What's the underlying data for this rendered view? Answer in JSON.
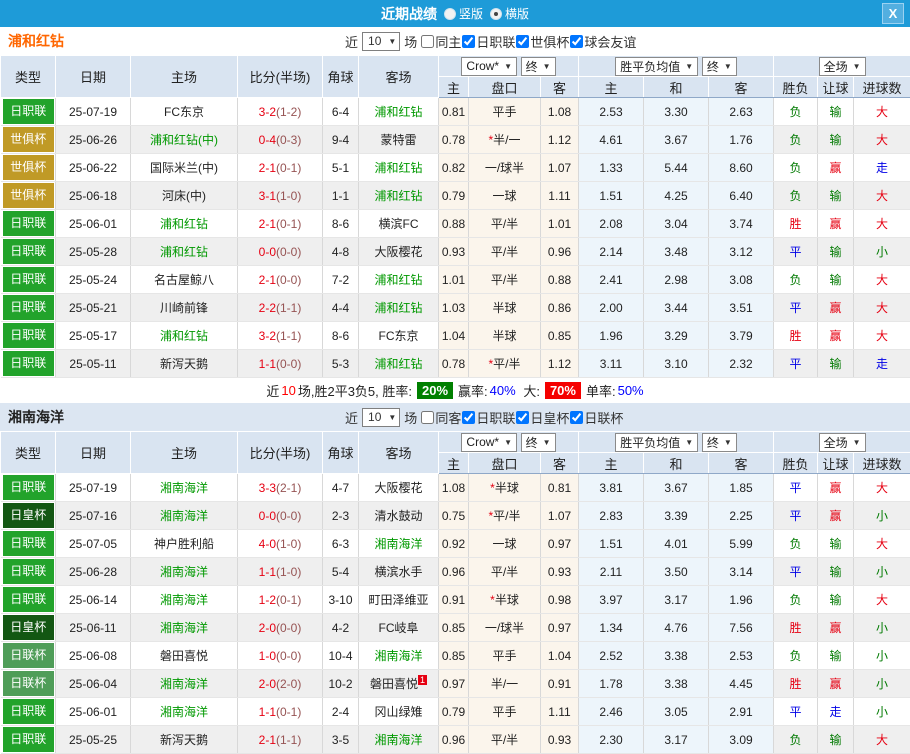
{
  "titlebar": {
    "title": "近期战绩",
    "radio_vertical": "竖版",
    "radio_horizontal": "横版",
    "horizontal_selected": true,
    "close_glyph": "X",
    "bar_color": "#1E9BD8"
  },
  "table_header": {
    "type": "类型",
    "date": "日期",
    "home": "主场",
    "score": "比分(半场)",
    "corner": "角球",
    "away": "客场",
    "company": "Crow*",
    "final": "终",
    "avg": "胜平负均值",
    "final2": "终",
    "scope": "全场",
    "h": "主",
    "handicap": "盘口",
    "a": "客",
    "h2": "主",
    "draw": "和",
    "a2": "客",
    "wdl": "胜负",
    "let": "让球",
    "goals": "进球数"
  },
  "sections": [
    {
      "team": "浦和红钻",
      "filters": {
        "near_label": "近",
        "count": "10",
        "games_label": "场",
        "checkboxes": [
          {
            "label": "同主",
            "checked": false
          },
          {
            "label": "日职联",
            "checked": true
          },
          {
            "label": "世俱杯",
            "checked": true
          },
          {
            "label": "球会友谊",
            "checked": true
          }
        ]
      },
      "rows": [
        {
          "lg": "日职联",
          "lgc": "#22A32B",
          "d": "25-07-19",
          "h": "FC东京",
          "hg": false,
          "s": "3-2",
          "ht": "(1-2)",
          "cn": "6-4",
          "a": "浦和红钻",
          "ag": true,
          "o1": "0.81",
          "st": false,
          "hc": "平手",
          "o2": "1.08",
          "m1": "2.53",
          "m2": "3.30",
          "m3": "2.63",
          "r1": [
            "负",
            "g"
          ],
          "r2": [
            "输",
            "g"
          ],
          "r3": [
            "大",
            "r"
          ]
        },
        {
          "lg": "世俱杯",
          "lgc": "#C09A26",
          "d": "25-06-26",
          "h": "浦和红钻(中)",
          "hg": true,
          "s": "0-4",
          "ht": "(0-3)",
          "cn": "9-4",
          "a": "蒙特雷",
          "ag": false,
          "o1": "0.78",
          "st": true,
          "hc": "半/一",
          "o2": "1.12",
          "m1": "4.61",
          "m2": "3.67",
          "m3": "1.76",
          "r1": [
            "负",
            "g"
          ],
          "r2": [
            "输",
            "g"
          ],
          "r3": [
            "大",
            "r"
          ]
        },
        {
          "lg": "世俱杯",
          "lgc": "#C09A26",
          "d": "25-06-22",
          "h": "国际米兰(中)",
          "hg": false,
          "s": "2-1",
          "ht": "(0-1)",
          "cn": "5-1",
          "a": "浦和红钻",
          "ag": true,
          "o1": "0.82",
          "st": false,
          "hc": "一/球半",
          "o2": "1.07",
          "m1": "1.33",
          "m2": "5.44",
          "m3": "8.60",
          "r1": [
            "负",
            "g"
          ],
          "r2": [
            "赢",
            "r"
          ],
          "r3": [
            "走",
            "b"
          ]
        },
        {
          "lg": "世俱杯",
          "lgc": "#C09A26",
          "d": "25-06-18",
          "h": "河床(中)",
          "hg": false,
          "s": "3-1",
          "ht": "(1-0)",
          "cn": "1-1",
          "a": "浦和红钻",
          "ag": true,
          "o1": "0.79",
          "st": false,
          "hc": "一球",
          "o2": "1.11",
          "m1": "1.51",
          "m2": "4.25",
          "m3": "6.40",
          "r1": [
            "负",
            "g"
          ],
          "r2": [
            "输",
            "g"
          ],
          "r3": [
            "大",
            "r"
          ]
        },
        {
          "lg": "日职联",
          "lgc": "#22A32B",
          "d": "25-06-01",
          "h": "浦和红钻",
          "hg": true,
          "s": "2-1",
          "ht": "(0-1)",
          "cn": "8-6",
          "a": "横滨FC",
          "ag": false,
          "o1": "0.88",
          "st": false,
          "hc": "平/半",
          "o2": "1.01",
          "m1": "2.08",
          "m2": "3.04",
          "m3": "3.74",
          "r1": [
            "胜",
            "r"
          ],
          "r2": [
            "赢",
            "r"
          ],
          "r3": [
            "大",
            "r"
          ]
        },
        {
          "lg": "日职联",
          "lgc": "#22A32B",
          "d": "25-05-28",
          "h": "浦和红钻",
          "hg": true,
          "s": "0-0",
          "ht": "(0-0)",
          "cn": "4-8",
          "a": "大阪樱花",
          "ag": false,
          "o1": "0.93",
          "st": false,
          "hc": "平/半",
          "o2": "0.96",
          "m1": "2.14",
          "m2": "3.48",
          "m3": "3.12",
          "r1": [
            "平",
            "b"
          ],
          "r2": [
            "输",
            "g"
          ],
          "r3": [
            "小",
            "g"
          ]
        },
        {
          "lg": "日职联",
          "lgc": "#22A32B",
          "d": "25-05-24",
          "h": "名古屋鲸八",
          "hg": false,
          "s": "2-1",
          "ht": "(0-0)",
          "cn": "7-2",
          "a": "浦和红钻",
          "ag": true,
          "o1": "1.01",
          "st": false,
          "hc": "平/半",
          "o2": "0.88",
          "m1": "2.41",
          "m2": "2.98",
          "m3": "3.08",
          "r1": [
            "负",
            "g"
          ],
          "r2": [
            "输",
            "g"
          ],
          "r3": [
            "大",
            "r"
          ]
        },
        {
          "lg": "日职联",
          "lgc": "#22A32B",
          "d": "25-05-21",
          "h": "川崎前锋",
          "hg": false,
          "s": "2-2",
          "ht": "(1-1)",
          "cn": "4-4",
          "a": "浦和红钻",
          "ag": true,
          "o1": "1.03",
          "st": false,
          "hc": "半球",
          "o2": "0.86",
          "m1": "2.00",
          "m2": "3.44",
          "m3": "3.51",
          "r1": [
            "平",
            "b"
          ],
          "r2": [
            "赢",
            "r"
          ],
          "r3": [
            "大",
            "r"
          ]
        },
        {
          "lg": "日职联",
          "lgc": "#22A32B",
          "d": "25-05-17",
          "h": "浦和红钻",
          "hg": true,
          "s": "3-2",
          "ht": "(1-1)",
          "cn": "8-6",
          "a": "FC东京",
          "ag": false,
          "o1": "1.04",
          "st": false,
          "hc": "半球",
          "o2": "0.85",
          "m1": "1.96",
          "m2": "3.29",
          "m3": "3.79",
          "r1": [
            "胜",
            "r"
          ],
          "r2": [
            "赢",
            "r"
          ],
          "r3": [
            "大",
            "r"
          ]
        },
        {
          "lg": "日职联",
          "lgc": "#22A32B",
          "d": "25-05-11",
          "h": "新泻天鹅",
          "hg": false,
          "s": "1-1",
          "ht": "(0-0)",
          "cn": "5-3",
          "a": "浦和红钻",
          "ag": true,
          "o1": "0.78",
          "st": true,
          "hc": "平/半",
          "o2": "1.12",
          "m1": "3.11",
          "m2": "3.10",
          "m3": "2.32",
          "r1": [
            "平",
            "b"
          ],
          "r2": [
            "输",
            "g"
          ],
          "r3": [
            "走",
            "b"
          ]
        }
      ],
      "summary": {
        "near": "近",
        "count": "10",
        "record": "场,胜2平3负5, 胜率:",
        "win_rate": "20%",
        "label_win": "赢率:",
        "win_odds_rate": "40%",
        "label_big": "大:",
        "big_rate": "70%",
        "label_single": "单率:",
        "single_rate": "50%"
      }
    },
    {
      "team": "湘南海洋",
      "filters": {
        "near_label": "近",
        "count": "10",
        "games_label": "场",
        "checkboxes": [
          {
            "label": "同客",
            "checked": false
          },
          {
            "label": "日职联",
            "checked": true
          },
          {
            "label": "日皇杯",
            "checked": true
          },
          {
            "label": "日联杯",
            "checked": true
          }
        ]
      },
      "rows": [
        {
          "lg": "日职联",
          "lgc": "#22A32B",
          "d": "25-07-19",
          "h": "湘南海洋",
          "hg": true,
          "s": "3-3",
          "ht": "(2-1)",
          "cn": "4-7",
          "a": "大阪樱花",
          "ag": false,
          "o1": "1.08",
          "st": true,
          "hc": "半球",
          "o2": "0.81",
          "m1": "3.81",
          "m2": "3.67",
          "m3": "1.85",
          "r1": [
            "平",
            "b"
          ],
          "r2": [
            "赢",
            "r"
          ],
          "r3": [
            "大",
            "r"
          ]
        },
        {
          "lg": "日皇杯",
          "lgc": "#135713",
          "d": "25-07-16",
          "h": "湘南海洋",
          "hg": true,
          "s": "0-0",
          "ht": "(0-0)",
          "cn": "2-3",
          "a": "清水鼓动",
          "ag": false,
          "o1": "0.75",
          "st": true,
          "hc": "平/半",
          "o2": "1.07",
          "m1": "2.83",
          "m2": "3.39",
          "m3": "2.25",
          "r1": [
            "平",
            "b"
          ],
          "r2": [
            "赢",
            "r"
          ],
          "r3": [
            "小",
            "g"
          ]
        },
        {
          "lg": "日职联",
          "lgc": "#22A32B",
          "d": "25-07-05",
          "h": "神户胜利船",
          "hg": false,
          "s": "4-0",
          "ht": "(1-0)",
          "cn": "6-3",
          "a": "湘南海洋",
          "ag": true,
          "o1": "0.92",
          "st": false,
          "hc": "一球",
          "o2": "0.97",
          "m1": "1.51",
          "m2": "4.01",
          "m3": "5.99",
          "r1": [
            "负",
            "g"
          ],
          "r2": [
            "输",
            "g"
          ],
          "r3": [
            "大",
            "r"
          ]
        },
        {
          "lg": "日职联",
          "lgc": "#22A32B",
          "d": "25-06-28",
          "h": "湘南海洋",
          "hg": true,
          "s": "1-1",
          "ht": "(1-0)",
          "cn": "5-4",
          "a": "横滨水手",
          "ag": false,
          "o1": "0.96",
          "st": false,
          "hc": "平/半",
          "o2": "0.93",
          "m1": "2.11",
          "m2": "3.50",
          "m3": "3.14",
          "r1": [
            "平",
            "b"
          ],
          "r2": [
            "输",
            "g"
          ],
          "r3": [
            "小",
            "g"
          ]
        },
        {
          "lg": "日职联",
          "lgc": "#22A32B",
          "d": "25-06-14",
          "h": "湘南海洋",
          "hg": true,
          "s": "1-2",
          "ht": "(0-1)",
          "cn": "3-10",
          "a": "町田泽维亚",
          "ag": false,
          "o1": "0.91",
          "st": true,
          "hc": "半球",
          "o2": "0.98",
          "m1": "3.97",
          "m2": "3.17",
          "m3": "1.96",
          "r1": [
            "负",
            "g"
          ],
          "r2": [
            "输",
            "g"
          ],
          "r3": [
            "大",
            "r"
          ]
        },
        {
          "lg": "日皇杯",
          "lgc": "#135713",
          "d": "25-06-11",
          "h": "湘南海洋",
          "hg": true,
          "s": "2-0",
          "ht": "(0-0)",
          "cn": "4-2",
          "a": "FC岐阜",
          "ag": false,
          "o1": "0.85",
          "st": false,
          "hc": "一/球半",
          "o2": "0.97",
          "m1": "1.34",
          "m2": "4.76",
          "m3": "7.56",
          "r1": [
            "胜",
            "r"
          ],
          "r2": [
            "赢",
            "r"
          ],
          "r3": [
            "小",
            "g"
          ]
        },
        {
          "lg": "日联杯",
          "lgc": "#4F9D58",
          "d": "25-06-08",
          "h": "磐田喜悦",
          "hg": false,
          "s": "1-0",
          "ht": "(0-0)",
          "cn": "10-4",
          "a": "湘南海洋",
          "ag": true,
          "o1": "0.85",
          "st": false,
          "hc": "平手",
          "o2": "1.04",
          "m1": "2.52",
          "m2": "3.38",
          "m3": "2.53",
          "r1": [
            "负",
            "g"
          ],
          "r2": [
            "输",
            "g"
          ],
          "r3": [
            "小",
            "g"
          ]
        },
        {
          "lg": "日联杯",
          "lgc": "#4F9D58",
          "d": "25-06-04",
          "h": "湘南海洋",
          "hg": true,
          "s": "2-0",
          "ht": "(2-0)",
          "cn": "10-2",
          "a": "磐田喜悦",
          "ag": false,
          "asup": "1",
          "o1": "0.97",
          "st": false,
          "hc": "半/一",
          "o2": "0.91",
          "m1": "1.78",
          "m2": "3.38",
          "m3": "4.45",
          "r1": [
            "胜",
            "r"
          ],
          "r2": [
            "赢",
            "r"
          ],
          "r3": [
            "小",
            "g"
          ]
        },
        {
          "lg": "日职联",
          "lgc": "#22A32B",
          "d": "25-06-01",
          "h": "湘南海洋",
          "hg": true,
          "s": "1-1",
          "ht": "(0-1)",
          "cn": "2-4",
          "a": "冈山绿雉",
          "ag": false,
          "o1": "0.79",
          "st": false,
          "hc": "平手",
          "o2": "1.11",
          "m1": "2.46",
          "m2": "3.05",
          "m3": "2.91",
          "r1": [
            "平",
            "b"
          ],
          "r2": [
            "走",
            "b"
          ],
          "r3": [
            "小",
            "g"
          ]
        },
        {
          "lg": "日职联",
          "lgc": "#22A32B",
          "d": "25-05-25",
          "h": "新泻天鹅",
          "hg": false,
          "s": "2-1",
          "ht": "(1-1)",
          "cn": "3-5",
          "a": "湘南海洋",
          "ag": true,
          "o1": "0.96",
          "st": false,
          "hc": "平/半",
          "o2": "0.93",
          "m1": "2.30",
          "m2": "3.17",
          "m3": "3.09",
          "r1": [
            "负",
            "g"
          ],
          "r2": [
            "输",
            "g"
          ],
          "r3": [
            "大",
            "r"
          ]
        }
      ]
    }
  ]
}
